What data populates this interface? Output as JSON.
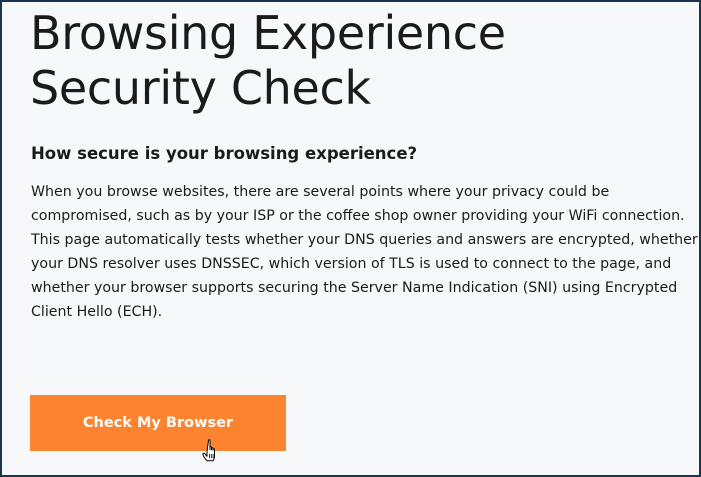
{
  "page": {
    "title": "Browsing Experience Security Check",
    "subtitle": "How secure is your browsing experience?",
    "description": "When you browse websites, there are several points where your privacy could be compromised, such as by your ISP or the coffee shop owner providing your WiFi connection. This page automatically tests whether your DNS queries and answers are encrypted, whether your DNS resolver uses DNSSEC, which version of TLS is used to connect to the page, and whether your browser supports securing the Server Name Indication (SNI) using Encrypted Client Hello (ECH)."
  },
  "cta": {
    "label": "Check My Browser",
    "color": "#fc8431"
  },
  "cursor": {
    "icon": "hand-pointer-icon"
  }
}
